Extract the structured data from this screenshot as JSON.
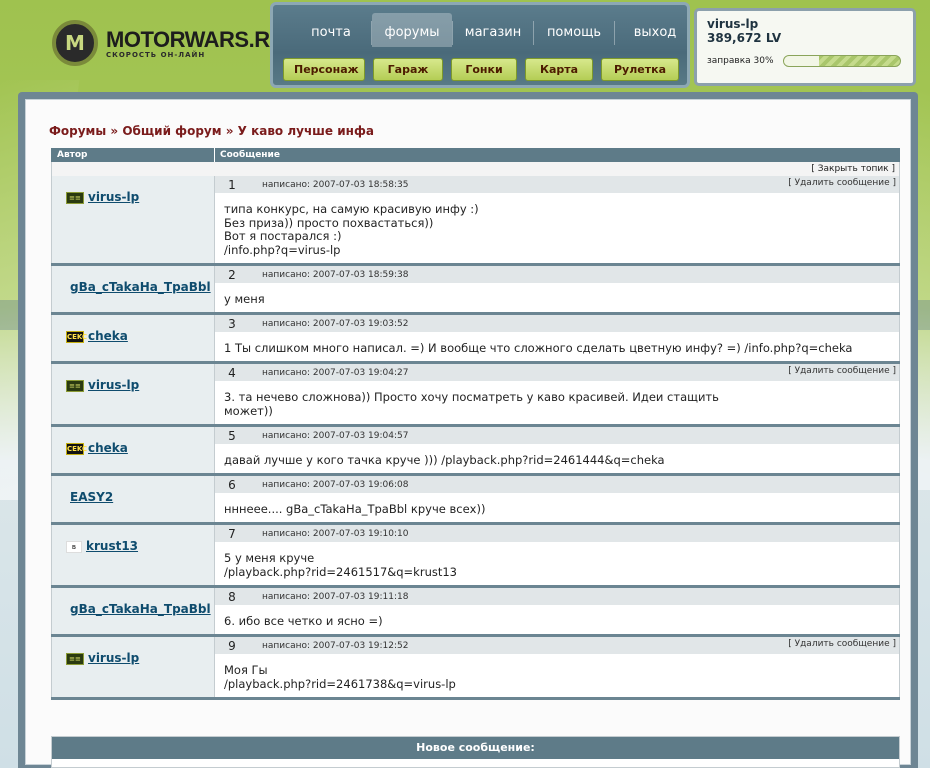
{
  "site": {
    "logo_mark": "M",
    "logo_title": "MOTORWARS.RU",
    "logo_sub": "СКОРОСТЬ ОН-ЛАЙН"
  },
  "nav": {
    "top": [
      "почта",
      "форумы",
      "магазин",
      "помощь",
      "выход"
    ],
    "active": "форумы",
    "bottom": [
      "Персонаж",
      "Гараж",
      "Гонки",
      "Карта",
      "Рулетка"
    ]
  },
  "user": {
    "name": "virus-lp",
    "lv": "389,672 LV",
    "fuel_label": "заправка 30%",
    "fuel_percent": 30
  },
  "forum": {
    "breadcrumb": "Форумы » Общий форум » У каво лучше инфа",
    "col_author": "Автор",
    "col_message": "Сообщение",
    "close_topic": "[ Закрыть топик ]",
    "delete_label": "[ Удалить сообщение ]",
    "posts": [
      {
        "num": "1",
        "author": "virus-lp",
        "badge": "green",
        "date": "написано: 2007-07-03 18:58:35",
        "deletable": true,
        "text": "типа конкурс, на самую красивую инфу :)\nБез приза)) просто похвастаться))\nВот я постарался :)\n/info.php?q=virus-lp"
      },
      {
        "num": "2",
        "author": "gBa_cTakaHa_TpaBbl",
        "badge": "",
        "date": "написано: 2007-07-03 18:59:38",
        "deletable": false,
        "text": "у меня"
      },
      {
        "num": "3",
        "author": "cheka",
        "badge": "yellow",
        "date": "написано: 2007-07-03 19:03:52",
        "deletable": false,
        "text": "1 Ты слишком много написал. =) И вообще что сложного сделать цветную инфу? =) /info.php?q=cheka"
      },
      {
        "num": "4",
        "author": "virus-lp",
        "badge": "green",
        "date": "написано: 2007-07-03 19:04:27",
        "deletable": true,
        "text": "3. та нечево сложнова)) Просто хочу посматреть у каво красивей. Идеи стащить\nможет))"
      },
      {
        "num": "5",
        "author": "cheka",
        "badge": "yellow",
        "date": "написано: 2007-07-03 19:04:57",
        "deletable": false,
        "text": "давай лучше у кого тачка круче ))) /playback.php?rid=2461444&q=cheka"
      },
      {
        "num": "6",
        "author": "EASY2",
        "badge": "",
        "date": "написано: 2007-07-03 19:06:08",
        "deletable": false,
        "text": "нннеее.... gBa_cTakaHa_TpaBbl круче всех))"
      },
      {
        "num": "7",
        "author": "krust13",
        "badge": "white",
        "date": "написано: 2007-07-03 19:10:10",
        "deletable": false,
        "text": "5 у меня круче\n/playback.php?rid=2461517&q=krust13"
      },
      {
        "num": "8",
        "author": "gBa_cTakaHa_TpaBbl",
        "badge": "",
        "date": "написано: 2007-07-03 19:11:18",
        "deletable": false,
        "text": "6. ибо все четко и ясно =)"
      },
      {
        "num": "9",
        "author": "virus-lp",
        "badge": "green",
        "date": "написано: 2007-07-03 19:12:52",
        "deletable": true,
        "text": "Моя Гы\n/playback.php?rid=2461738&q=virus-lp"
      }
    ],
    "new_message": "Новое сообщение:",
    "badges": {
      "green": "≡≡",
      "yellow": "CEKC",
      "white": "в"
    }
  }
}
